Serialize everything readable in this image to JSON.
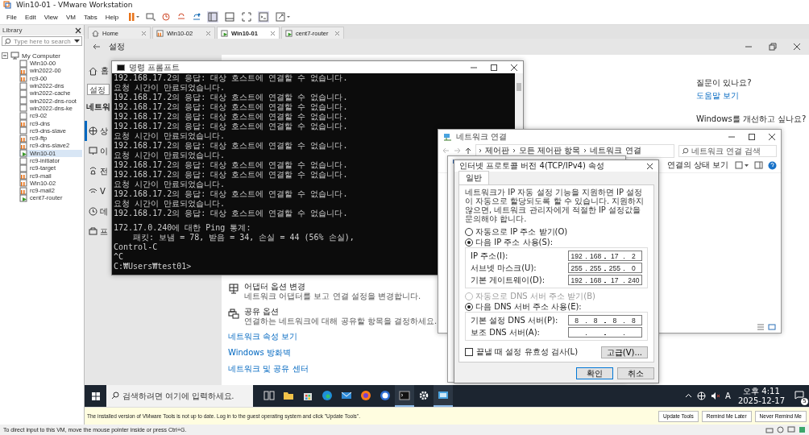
{
  "window": {
    "title": "Win10-01 - VMware Workstation"
  },
  "menu": [
    "File",
    "Edit",
    "View",
    "VM",
    "Tabs",
    "Help"
  ],
  "library": {
    "title": "Library",
    "search": {
      "placeholder": "Type here to search"
    },
    "root": {
      "label": "My Computer",
      "expanded": true,
      "children": [
        {
          "label": "Win10-00",
          "kind": "off",
          "selected": false
        },
        {
          "label": "win2022-00",
          "kind": "suspended",
          "selected": false
        },
        {
          "label": "rc9-00",
          "kind": "suspended",
          "selected": false
        },
        {
          "label": "win2022-dns",
          "kind": "off",
          "selected": false
        },
        {
          "label": "win2022-cache",
          "kind": "off",
          "selected": false
        },
        {
          "label": "win2022-dns-root",
          "kind": "off",
          "selected": false
        },
        {
          "label": "win2022-dns-ke",
          "kind": "off",
          "selected": false
        },
        {
          "label": "rc9-02",
          "kind": "off",
          "selected": false
        },
        {
          "label": "rc9-dns",
          "kind": "suspended",
          "selected": false
        },
        {
          "label": "rc9-dns-slave",
          "kind": "off",
          "selected": false
        },
        {
          "label": "rc9-ftp",
          "kind": "suspended",
          "selected": false
        },
        {
          "label": "rc9-dns-slave2",
          "kind": "suspended",
          "selected": false
        },
        {
          "label": "Win10-01",
          "kind": "running",
          "selected": true
        },
        {
          "label": "rc9-initiator",
          "kind": "off",
          "selected": false
        },
        {
          "label": "rc9-target",
          "kind": "off",
          "selected": false
        },
        {
          "label": "rc9-mail",
          "kind": "suspended",
          "selected": false
        },
        {
          "label": "Win10-02",
          "kind": "suspended",
          "selected": false
        },
        {
          "label": "rc9-mail2",
          "kind": "suspended",
          "selected": false
        },
        {
          "label": "cent7-router",
          "kind": "running",
          "selected": false
        }
      ]
    }
  },
  "tabs": [
    {
      "label": "Home",
      "kind": "home",
      "selected": false
    },
    {
      "label": "Win10-02",
      "kind": "suspended",
      "selected": false
    },
    {
      "label": "Win10-01",
      "kind": "running",
      "selected": true
    },
    {
      "label": "cent7-router",
      "kind": "running",
      "selected": false
    }
  ],
  "guest": {
    "settings": {
      "title": "설정",
      "home": "홈",
      "search": {
        "placeholder": "설정"
      },
      "heading": "네트워",
      "nav": [
        {
          "label": "상",
          "kind": "status",
          "selected": true
        },
        {
          "label": "이",
          "kind": "ethernet",
          "selected": false
        },
        {
          "label": "전",
          "kind": "dialup",
          "selected": false
        },
        {
          "label": "V",
          "kind": "vpn",
          "selected": false
        },
        {
          "label": "데",
          "kind": "usage",
          "selected": false
        },
        {
          "label": "프",
          "kind": "proxy",
          "selected": false
        }
      ],
      "help": {
        "question": "질문이 있나요?",
        "link": "도움말 보기",
        "improve": "Windows를 개선하고 싶나요?"
      },
      "options": [
        {
          "kind": "adapter",
          "title": "어댑터 옵션 변경",
          "description": "네트워크 어댑터를 보고 연결 설정을 변경합니다."
        },
        {
          "kind": "sharing",
          "title": "공유 옵션",
          "description": "연결하는 네트워크에 대해 공유할 항목을 결정하세요."
        }
      ],
      "links": [
        "네트워크 속성 보기",
        "Windows 방화벽",
        "네트워크 및 공유 센터"
      ]
    },
    "cmd": {
      "title": "명령 프롬프트",
      "lines": [
        "192.168.17.2의 응답: 대상 호스트에 연결할 수 없습니다.",
        "요청 시간이 만료되었습니다.",
        "192.168.17.2의 응답: 대상 호스트에 연결할 수 없습니다.",
        "192.168.17.2의 응답: 대상 호스트에 연결할 수 없습니다.",
        "192.168.17.2의 응답: 대상 호스트에 연결할 수 없습니다.",
        "192.168.17.2의 응답: 대상 호스트에 연결할 수 없습니다.",
        "요청 시간이 만료되었습니다.",
        "192.168.17.2의 응답: 대상 호스트에 연결할 수 없습니다.",
        "요청 시간이 만료되었습니다.",
        "192.168.17.2의 응답: 대상 호스트에 연결할 수 없습니다.",
        "192.168.17.2의 응답: 대상 호스트에 연결할 수 없습니다.",
        "요청 시간이 만료되었습니다.",
        "192.168.17.2의 응답: 대상 호스트에 연결할 수 없습니다.",
        "요청 시간이 만료되었습니다.",
        "192.168.17.2의 응답: 대상 호스트에 연결할 수 없습니다.",
        "172.17.0.240에 대한 Ping 통계:",
        "    패킷: 보냄 = 78, 받음 = 34, 손실 = 44 (56% 손실),",
        "Control-C",
        "^C",
        "C:₩Users₩test01>"
      ]
    },
    "network_connections": {
      "title": "네트워크 연결",
      "breadcrumb": [
        "제어판",
        "모든 제어판 항목",
        "네트워크 연결"
      ],
      "search": {
        "placeholder": "네트워크 연결 검색"
      },
      "action": "연결의 상태 보기"
    },
    "ipv4_dialog": {
      "title": "인터넷 프로토콜 버전 4(TCP/IPv4) 속성",
      "tab": "일반",
      "description": "네트워크가 IP 자동 설정 기능을 지원하면 IP 설정이 자동으로 할당되도록 할 수 있습니다. 지원하지 않으면, 네트워크 관리자에게 적절한 IP 설정값을 문의해야 합니다.",
      "ip_modes": [
        {
          "label": "자동으로 IP 주소 받기(O)",
          "selected": false,
          "disabled": false
        },
        {
          "label": "다음 IP 주소 사용(S):",
          "selected": true,
          "disabled": false
        }
      ],
      "ip_fields": [
        {
          "label": "IP 주소(I):",
          "octets": [
            "192",
            "168",
            "17",
            "2"
          ]
        },
        {
          "label": "서브넷 마스크(U):",
          "octets": [
            "255",
            "255",
            "255",
            "0"
          ]
        },
        {
          "label": "기본 게이트웨이(D):",
          "octets": [
            "192",
            "168",
            "17",
            "240"
          ]
        }
      ],
      "dns_modes": [
        {
          "label": "자동으로 DNS 서버 주소 받기(B)",
          "selected": false,
          "disabled": true
        },
        {
          "label": "다음 DNS 서버 주소 사용(E):",
          "selected": true,
          "disabled": false
        }
      ],
      "dns_fields": [
        {
          "label": "기본 설정 DNS 서버(P):",
          "octets": [
            "8",
            "8",
            "8",
            "8"
          ]
        },
        {
          "label": "보조 DNS 서버(A):"
        }
      ],
      "validate": {
        "label": "끝낼 때 설정 유효성 검사(L)",
        "checked": false
      },
      "advanced": "고급(V)...",
      "buttons": [
        {
          "label": "확인",
          "default": true
        },
        {
          "label": "취소",
          "default": false
        }
      ]
    },
    "taskbar": {
      "search": {
        "placeholder": "검색하려면 여기에 입력하세요."
      },
      "apps": [
        {
          "kind": "taskview",
          "active": false
        },
        {
          "kind": "folder",
          "active": false
        },
        {
          "kind": "store",
          "active": false
        },
        {
          "kind": "edge",
          "active": false
        },
        {
          "kind": "mail",
          "active": false
        },
        {
          "kind": "firefox",
          "active": false
        },
        {
          "kind": "globe",
          "active": false
        },
        {
          "kind": "terminal",
          "active": true
        },
        {
          "kind": "gear",
          "active": false
        },
        {
          "kind": "network",
          "active": true
        }
      ],
      "input_mode": "A",
      "time": "오후 4:11",
      "date": "2025-12-17",
      "notifications": "5"
    }
  },
  "tools_bar": {
    "message": "The installed version of VMware Tools is not up to date. Log in to the guest operating system and click \"Update Tools\".",
    "buttons": [
      "Update Tools",
      "Remind Me Later",
      "Never Remind Me"
    ]
  },
  "status_bar": "To direct input to this VM, move the mouse pointer inside or press Ctrl+G."
}
